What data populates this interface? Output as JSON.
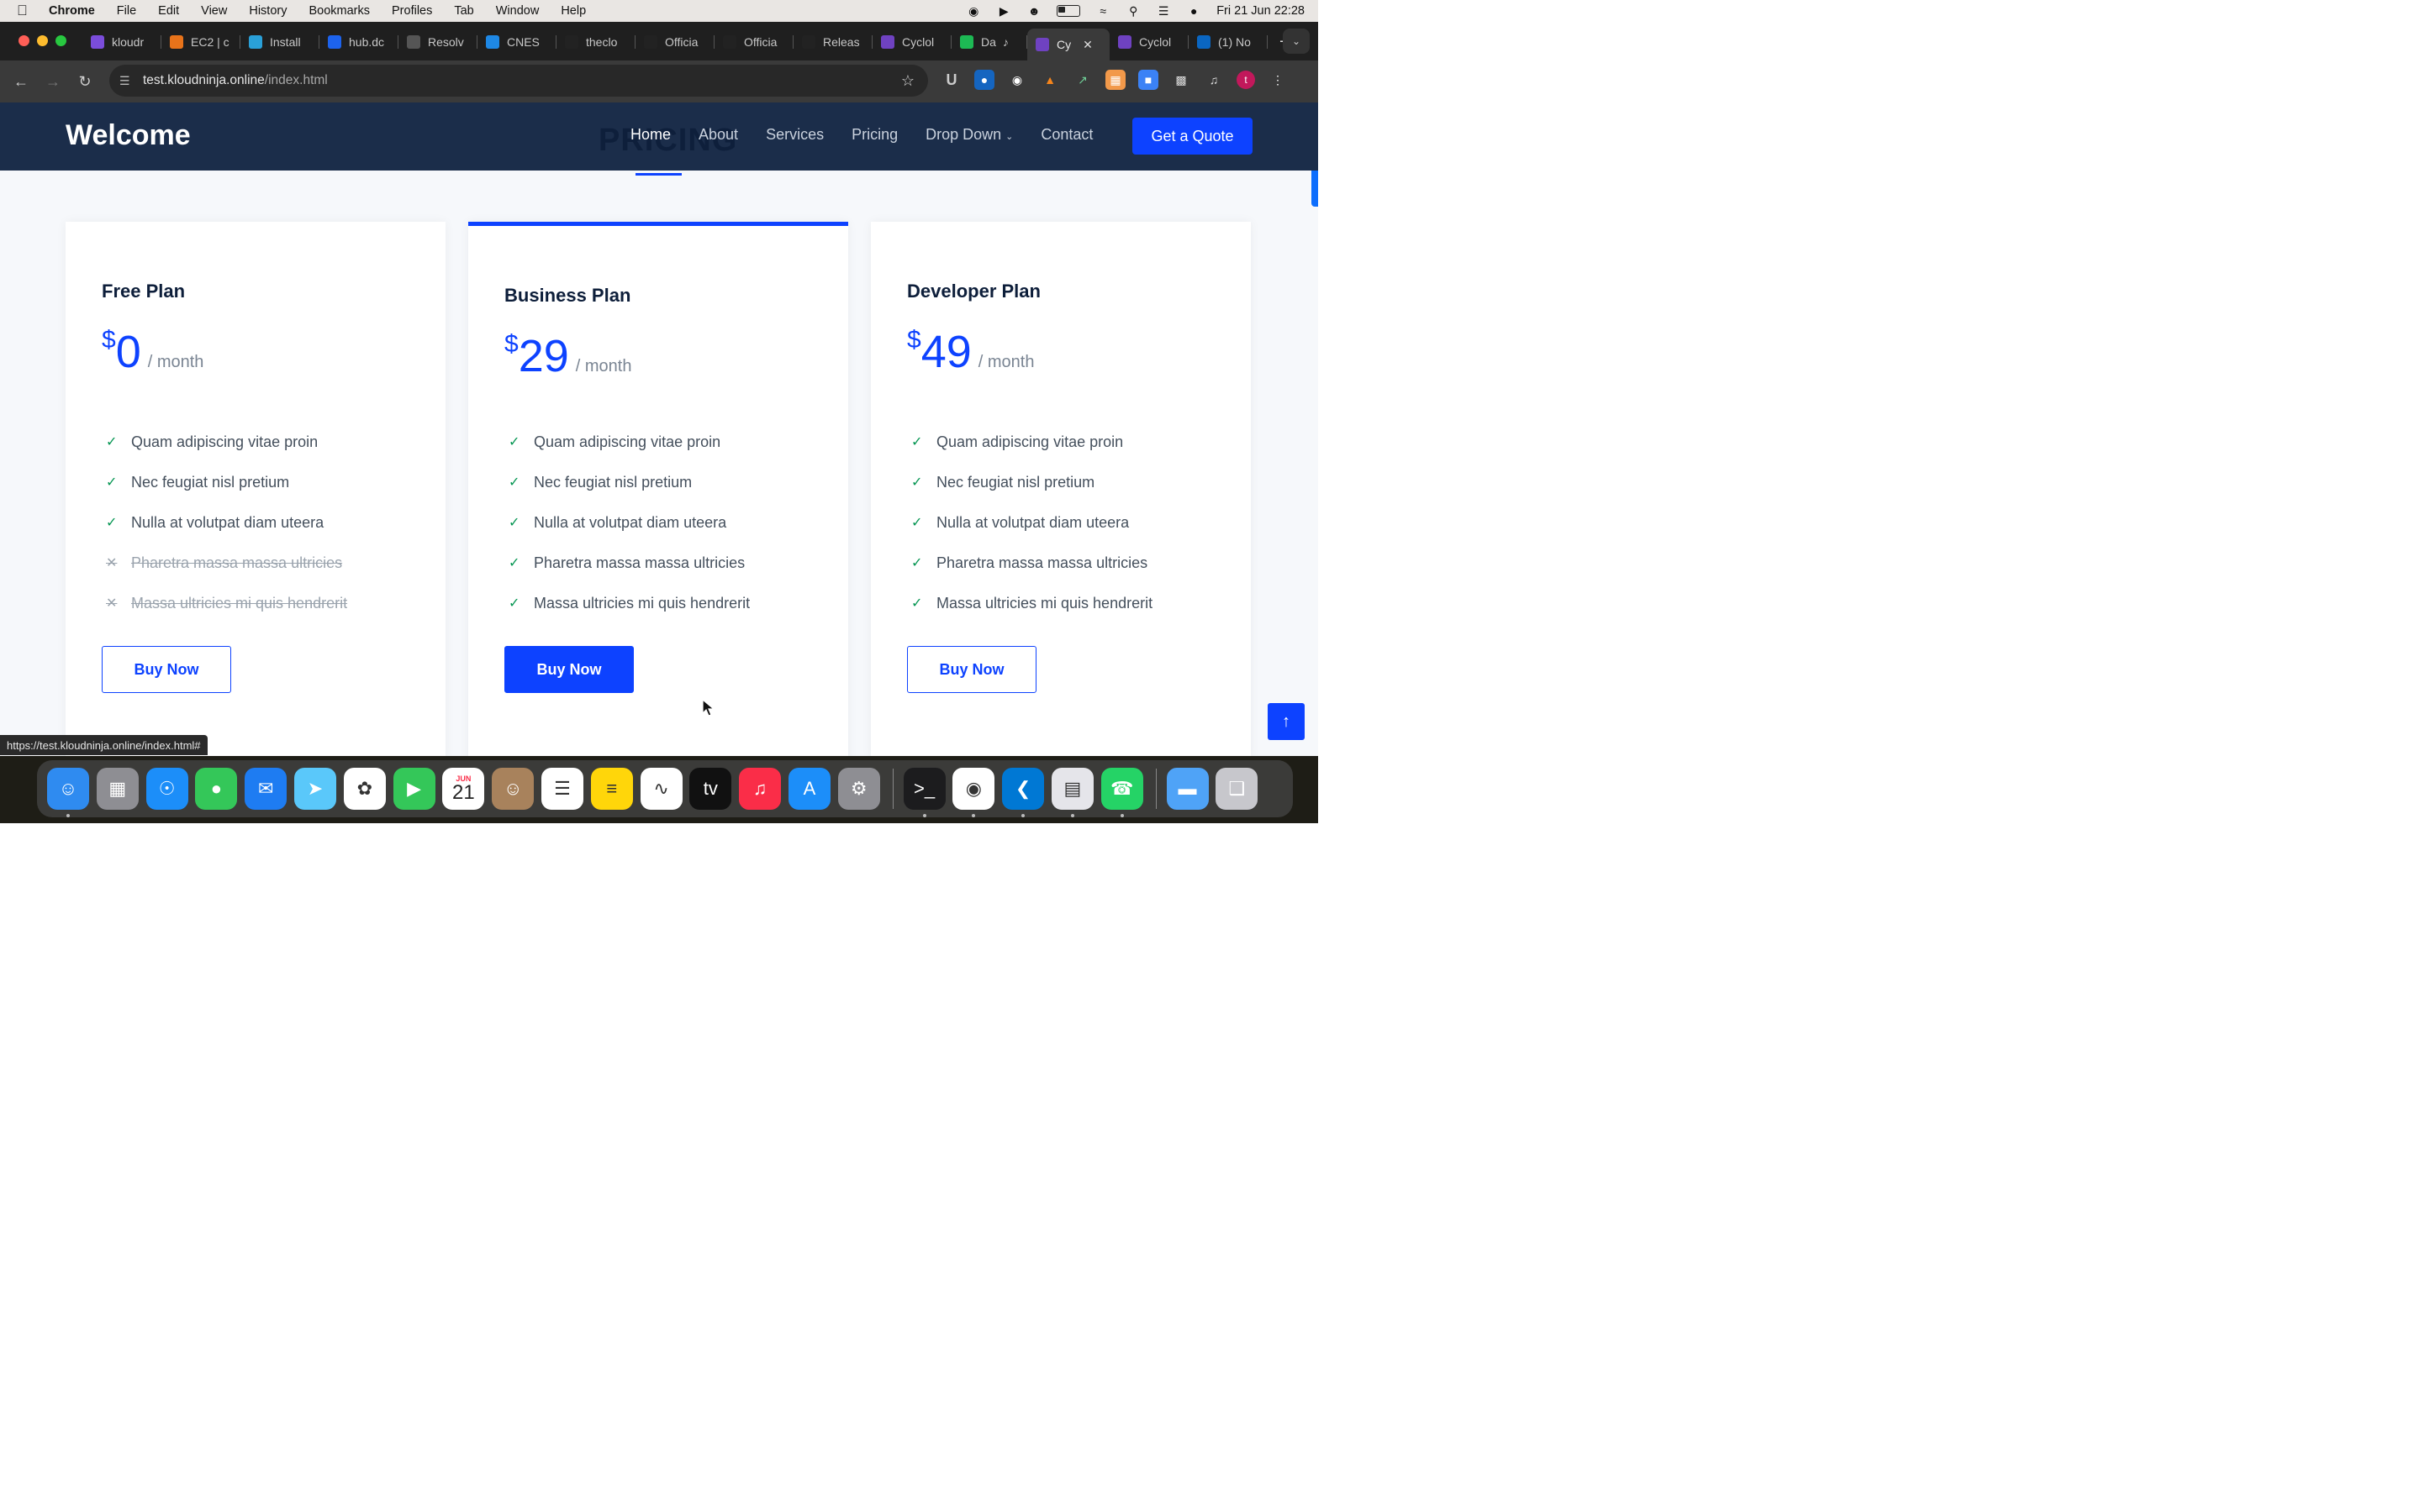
{
  "menubar": {
    "app_name": "Chrome",
    "items": [
      "File",
      "Edit",
      "View",
      "History",
      "Bookmarks",
      "Profiles",
      "Tab",
      "Window",
      "Help"
    ],
    "datetime": "Fri 21 Jun  22:28"
  },
  "tabs": [
    {
      "title": "kloudr",
      "favicon_color": "#7b4ddb"
    },
    {
      "title": "EC2 | c",
      "favicon_color": "#e8731a"
    },
    {
      "title": "Install",
      "favicon_color": "#2aa0d8"
    },
    {
      "title": "hub.dc",
      "favicon_color": "#1d63ed"
    },
    {
      "title": "Resolv",
      "favicon_color": "#555555"
    },
    {
      "title": "CNES",
      "favicon_color": "#1e88e5"
    },
    {
      "title": "theclo",
      "favicon_color": "#222222"
    },
    {
      "title": "Officia",
      "favicon_color": "#222222"
    },
    {
      "title": "Officia",
      "favicon_color": "#222222"
    },
    {
      "title": "Releas",
      "favicon_color": "#222222"
    },
    {
      "title": "Cyclol",
      "favicon_color": "#6f42c1"
    },
    {
      "title": "Da",
      "favicon_color": "#1db954"
    },
    {
      "title": "Cy",
      "favicon_color": "#6f42c1",
      "active": true
    },
    {
      "title": "Cyclol",
      "favicon_color": "#6f42c1"
    },
    {
      "title": "(1) No",
      "favicon_color": "#0a66c2"
    }
  ],
  "omnibox": {
    "host": "test.kloudninja.online",
    "path": "/index.html"
  },
  "site": {
    "logo": "Welcome",
    "ghost_section_title": "PRICING",
    "nav": [
      "Home",
      "About",
      "Services",
      "Pricing",
      "Drop Down",
      "Contact"
    ],
    "cta": "Get a Quote"
  },
  "plans": [
    {
      "name": "Free Plan",
      "currency": "$",
      "price": "0",
      "period": "/ month",
      "features": [
        {
          "text": "Quam adipiscing vitae proin",
          "included": true
        },
        {
          "text": "Nec feugiat nisl pretium",
          "included": true
        },
        {
          "text": "Nulla at volutpat diam uteera",
          "included": true
        },
        {
          "text": "Pharetra massa massa ultricies",
          "included": false
        },
        {
          "text": "Massa ultricies mi quis hendrerit",
          "included": false
        }
      ],
      "button": "Buy Now"
    },
    {
      "name": "Business Plan",
      "currency": "$",
      "price": "29",
      "period": "/ month",
      "features": [
        {
          "text": "Quam adipiscing vitae proin",
          "included": true
        },
        {
          "text": "Nec feugiat nisl pretium",
          "included": true
        },
        {
          "text": "Nulla at volutpat diam uteera",
          "included": true
        },
        {
          "text": "Pharetra massa massa ultricies",
          "included": true
        },
        {
          "text": "Massa ultricies mi quis hendrerit",
          "included": true
        }
      ],
      "button": "Buy Now"
    },
    {
      "name": "Developer Plan",
      "currency": "$",
      "price": "49",
      "period": "/ month",
      "features": [
        {
          "text": "Quam adipiscing vitae proin",
          "included": true
        },
        {
          "text": "Nec feugiat nisl pretium",
          "included": true
        },
        {
          "text": "Nulla at volutpat diam uteera",
          "included": true
        },
        {
          "text": "Pharetra massa massa ultricies",
          "included": true
        },
        {
          "text": "Massa ultricies mi quis hendrerit",
          "included": true
        }
      ],
      "button": "Buy Now"
    }
  ],
  "status_url": "https://test.kloudninja.online/index.html#",
  "dock": {
    "calendar_month": "JUN",
    "calendar_day": "21",
    "apps": [
      "finder-icon",
      "launchpad-icon",
      "safari-icon",
      "messages-icon",
      "mail-icon",
      "maps-icon",
      "photos-icon",
      "facetime-icon",
      "calendar-icon",
      "contacts-icon",
      "reminders-icon",
      "notes-icon",
      "freeform-icon",
      "apple-tv-icon",
      "music-icon",
      "app-store-icon",
      "system-settings-icon",
      "terminal-icon",
      "chrome-icon",
      "vscode-icon",
      "preview-icon",
      "whatsapp-icon",
      "downloads-folder-icon",
      "trash-icon"
    ]
  },
  "colors": {
    "accent": "#0d42ff",
    "header_bg": "#1b2d4a",
    "check": "#059652"
  }
}
